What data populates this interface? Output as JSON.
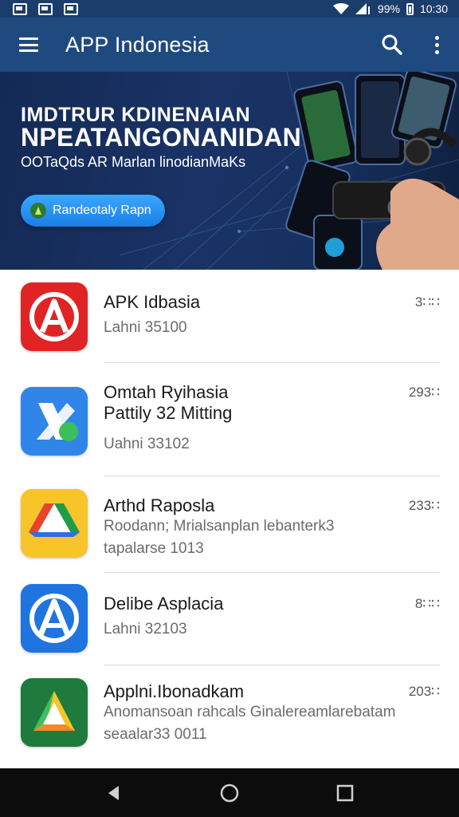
{
  "status_bar": {
    "battery": "99%",
    "time": "10:30",
    "icons": [
      "gallery-icon",
      "app-icon",
      "photo-icon",
      "wifi-icon",
      "signal-icon",
      "battery-icon"
    ]
  },
  "app_bar": {
    "title": "APP Indonesia",
    "icons": [
      "menu-icon",
      "search-icon",
      "more-vert-icon"
    ]
  },
  "banner": {
    "kicker": "IMDTRUR KDINENAIAN",
    "headline": "NPEATANGONANIDAN",
    "subtitle": "OOTaQds AR Marlan linodianMaKs",
    "cta_label": "Randeotaly Rapn"
  },
  "apps": [
    {
      "name": "APK Idbasia",
      "lines": [
        "Lahni 35100"
      ],
      "count": "3∷∷",
      "icon": "red-a-icon"
    },
    {
      "name": "Omtah Ryihasia",
      "name2": "Pattily 32 Mitting",
      "lines": [
        "Uahni 33102"
      ],
      "count": "293∷",
      "icon": "blue-x-icon"
    },
    {
      "name": "Arthd Raposla",
      "lines": [
        "Roodann; Mrialsanplan lebanterk3",
        "tapalarse 1013"
      ],
      "count": "233∷",
      "icon": "drive-triangle-icon"
    },
    {
      "name": "Delibe Asplacia",
      "lines": [
        "Lahni 32103"
      ],
      "count": "8∷∷",
      "icon": "blue-a-icon"
    },
    {
      "name": "Applni.Ibonadkam",
      "lines": [
        "Anomansoan rahcals Ginalereamlarebatam",
        "seaalar33 0011"
      ],
      "count": "203∷",
      "icon": "green-triangle-icon"
    }
  ],
  "nav_bar": {
    "icons": [
      "back-icon",
      "home-icon",
      "recents-icon"
    ]
  },
  "colors": {
    "status_bar": "#1b3d6b",
    "app_bar": "#1f4a7f",
    "cta": "#2a8ef5",
    "nav_bar": "#0c0c0c"
  }
}
